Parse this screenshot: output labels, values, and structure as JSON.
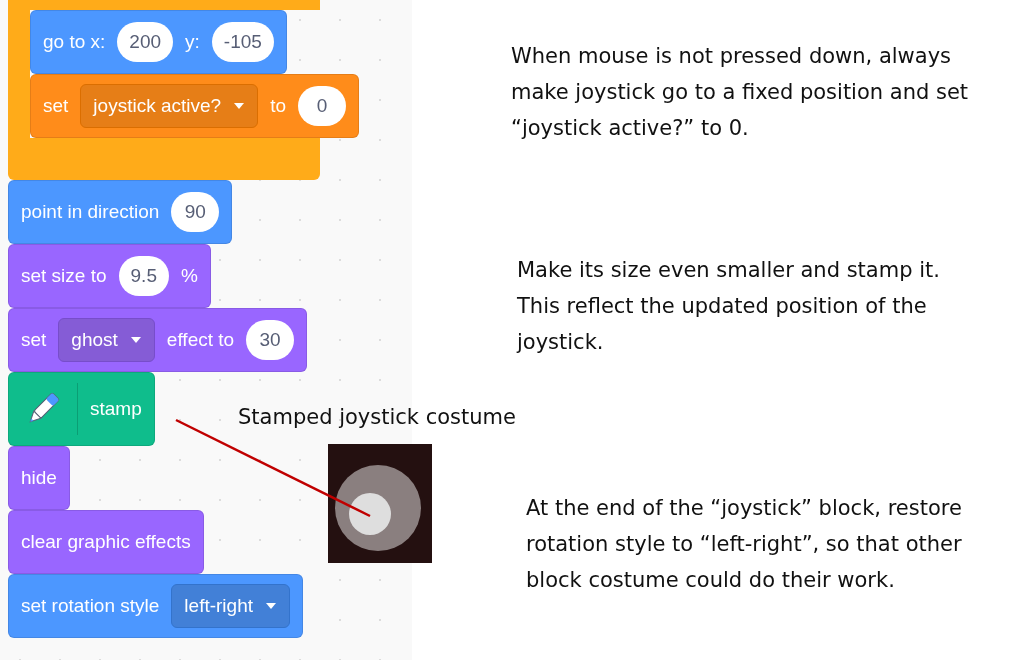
{
  "workspace": {
    "blocks": [
      {
        "kind": "control",
        "children": [
          {
            "kind": "motion",
            "parts": [
              {
                "kind": "text",
                "text": "go to x:"
              },
              {
                "kind": "input",
                "text": "200"
              },
              {
                "kind": "text",
                "text": "y:"
              },
              {
                "kind": "input",
                "text": "-105"
              }
            ]
          },
          {
            "kind": "variables",
            "parts": [
              {
                "kind": "text",
                "text": "set"
              },
              {
                "kind": "dropdown",
                "text": "joystick active?"
              },
              {
                "kind": "text",
                "text": "to"
              },
              {
                "kind": "input",
                "text": "0"
              }
            ]
          }
        ]
      },
      {
        "kind": "motion",
        "parts": [
          {
            "kind": "text",
            "text": "point in direction"
          },
          {
            "kind": "input",
            "text": "90"
          }
        ]
      },
      {
        "kind": "looks",
        "parts": [
          {
            "kind": "text",
            "text": "set size to"
          },
          {
            "kind": "input",
            "text": "9.5"
          },
          {
            "kind": "text",
            "text": "%"
          }
        ]
      },
      {
        "kind": "looks",
        "parts": [
          {
            "kind": "text",
            "text": "set"
          },
          {
            "kind": "dropdown",
            "text": "ghost"
          },
          {
            "kind": "text",
            "text": "effect to"
          },
          {
            "kind": "input",
            "text": "30"
          }
        ]
      },
      {
        "kind": "pen",
        "parts": [
          {
            "kind": "pen"
          },
          {
            "kind": "text",
            "text": "stamp"
          }
        ]
      },
      {
        "kind": "looks",
        "parts": [
          {
            "kind": "text",
            "text": "hide"
          }
        ]
      },
      {
        "kind": "looks",
        "parts": [
          {
            "kind": "text",
            "text": "clear graphic effects"
          }
        ]
      },
      {
        "kind": "motion",
        "parts": [
          {
            "kind": "text",
            "text": "set rotation style"
          },
          {
            "kind": "dropdown",
            "text": "left-right"
          }
        ]
      }
    ]
  },
  "annotations": [
    "When mouse is not pressed down, always make joystick go to a fixed position and set “joystick active?” to 0.",
    "Make its size even smaller and stamp it. This reflect the updated position of the joystick.",
    "At the end of the “joystick” block, restore rotation style to “left-right”, so that other block costume could do their work."
  ],
  "callout": {
    "label": "Stamped joystick costume"
  }
}
